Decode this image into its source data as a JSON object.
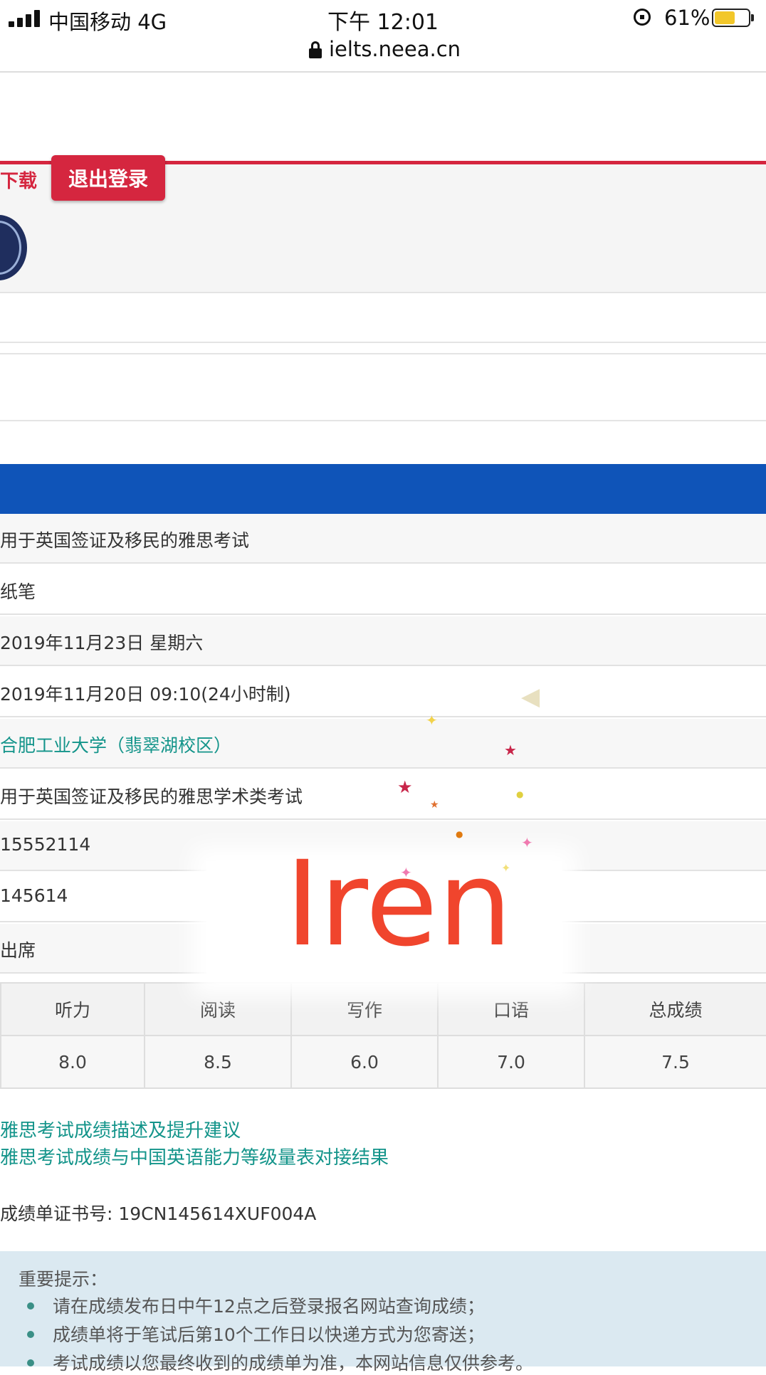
{
  "status_bar": {
    "carrier": "中国移动 4G",
    "time": "下午 12:01",
    "battery": "61%",
    "battery_level": 0.61,
    "signal_icon": "signal-bars-icon",
    "rotation_lock_icon": "rotation-lock-icon",
    "battery_icon": "battery-icon"
  },
  "browser": {
    "url": "ielts.neea.cn",
    "lock_icon": "lock-icon"
  },
  "header": {
    "download_label": "下载",
    "logout_label": "退出登录",
    "logo_icon": "ielts-emblem-icon",
    "accent_color": "#d5263f"
  },
  "info_rows": [
    {
      "value": "用于英国签证及移民的雅思考试",
      "is_link": false
    },
    {
      "value": "纸笔",
      "is_link": false
    },
    {
      "value": "2019年11月23日  星期六",
      "is_link": false
    },
    {
      "value": "2019年11月20日  09:10(24小时制)",
      "is_link": false
    },
    {
      "value": "合肥工业大学（翡翠湖校区）",
      "is_link": true
    },
    {
      "value": "用于英国签证及移民的雅思学术类考试",
      "is_link": false
    },
    {
      "value": "15552114",
      "is_link": false
    },
    {
      "value": "145614",
      "is_link": false
    },
    {
      "value": "出席",
      "is_link": false
    }
  ],
  "scores": {
    "headers": [
      "听力",
      "阅读",
      "写作",
      "口语",
      "总成绩"
    ],
    "values": [
      "8.0",
      "8.5",
      "6.0",
      "7.0",
      "7.5"
    ]
  },
  "links": {
    "describe": "雅思考试成绩描述及提升建议",
    "cse": "雅思考试成绩与中国英语能力等级量表对接结果"
  },
  "certificate": {
    "text": "成绩单证书号: 19CN145614XUF004A"
  },
  "notice": {
    "title": "重要提示：",
    "items": [
      "请在成绩发布日中午12点之后登录报名网站查询成绩；",
      "成绩单将于笔试后第10个工作日以快递方式为您寄送；",
      "考试成绩以您最终收到的成绩单为准，本网站信息仅供参考。"
    ]
  },
  "overlay": {
    "text": "Iren",
    "color": "#f0452d"
  }
}
